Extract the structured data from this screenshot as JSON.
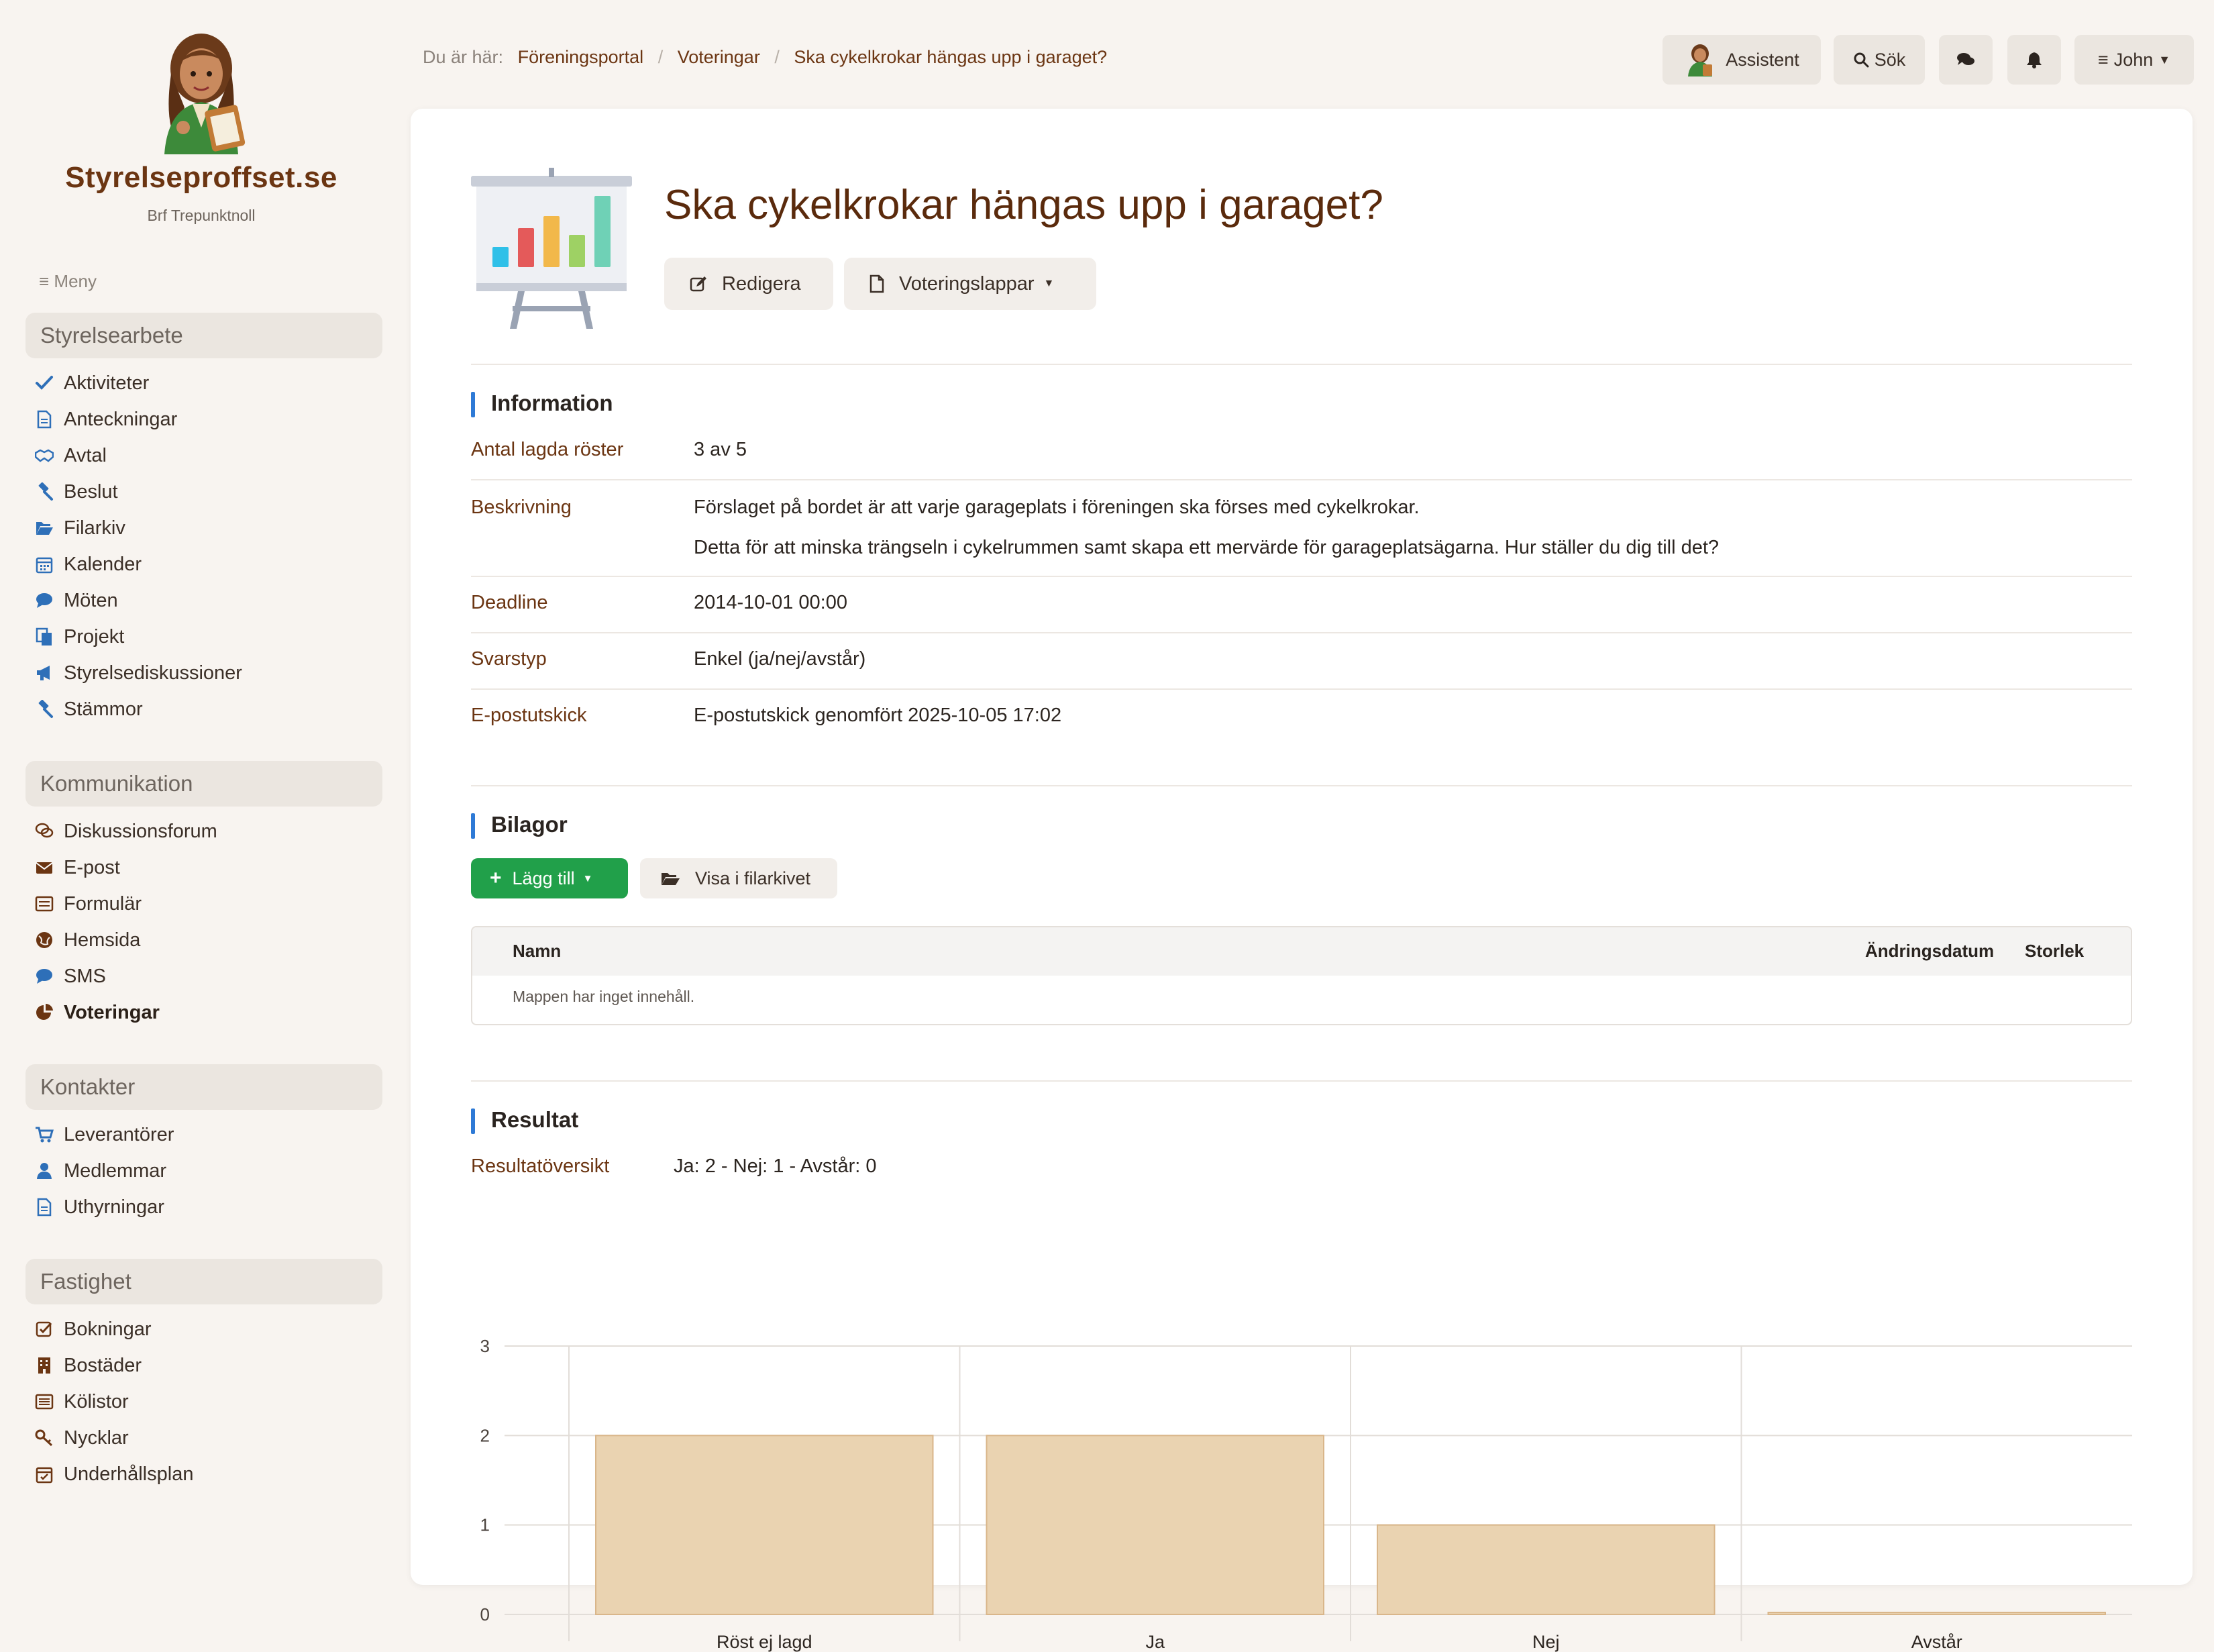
{
  "brand": {
    "name": "Styrelseproffset.se",
    "subtitle": "Brf Trepunktnoll"
  },
  "menu_label": "Meny",
  "sidebar": {
    "sections": [
      {
        "title": "Styrelsearbete",
        "items": [
          {
            "label": "Aktiviteter",
            "icon": "check-icon"
          },
          {
            "label": "Anteckningar",
            "icon": "document-icon"
          },
          {
            "label": "Avtal",
            "icon": "handshake-icon"
          },
          {
            "label": "Beslut",
            "icon": "gavel-icon"
          },
          {
            "label": "Filarkiv",
            "icon": "folder-open-icon"
          },
          {
            "label": "Kalender",
            "icon": "calendar-icon"
          },
          {
            "label": "Möten",
            "icon": "speech-bubble-icon"
          },
          {
            "label": "Projekt",
            "icon": "copy-icon"
          },
          {
            "label": "Styrelsediskussioner",
            "icon": "megaphone-icon"
          },
          {
            "label": "Stämmor",
            "icon": "gavel-icon"
          }
        ]
      },
      {
        "title": "Kommunikation",
        "items": [
          {
            "label": "Diskussionsforum",
            "icon": "comments-icon"
          },
          {
            "label": "E-post",
            "icon": "envelope-icon"
          },
          {
            "label": "Formulär",
            "icon": "form-icon"
          },
          {
            "label": "Hemsida",
            "icon": "globe-icon"
          },
          {
            "label": "SMS",
            "icon": "speech-bubble-icon"
          },
          {
            "label": "Voteringar",
            "icon": "pie-chart-icon",
            "active": true
          }
        ]
      },
      {
        "title": "Kontakter",
        "items": [
          {
            "label": "Leverantörer",
            "icon": "cart-icon"
          },
          {
            "label": "Medlemmar",
            "icon": "user-icon"
          },
          {
            "label": "Uthyrningar",
            "icon": "document-icon"
          }
        ]
      },
      {
        "title": "Fastighet",
        "items": [
          {
            "label": "Bokningar",
            "icon": "checkbox-icon"
          },
          {
            "label": "Bostäder",
            "icon": "building-icon"
          },
          {
            "label": "Kölistor",
            "icon": "list-icon"
          },
          {
            "label": "Nycklar",
            "icon": "key-icon"
          },
          {
            "label": "Underhållsplan",
            "icon": "calendar-check-icon"
          }
        ]
      }
    ]
  },
  "breadcrumb": {
    "prefix": "Du är här:",
    "items": [
      "Föreningsportal",
      "Voteringar",
      "Ska cykelkrokar hängas upp i garaget?"
    ]
  },
  "topbar": {
    "assistant": "Assistent",
    "search": "Sök",
    "user": "John"
  },
  "page": {
    "title": "Ska cykelkrokar hängas upp i garaget?",
    "edit_label": "Redigera",
    "ballots_label": "Voteringslappar"
  },
  "information": {
    "title": "Information",
    "rows": [
      {
        "key": "Antal lagda röster",
        "value": "3 av 5"
      },
      {
        "key": "Beskrivning",
        "value": "Förslaget på bordet är att varje garageplats i föreningen ska förses med cykelkrokar.",
        "value2": "Detta för att minska trängseln i cykelrummen samt skapa ett mervärde för garageplatsägarna. Hur ställer du dig till det?"
      },
      {
        "key": "Deadline",
        "value": "2014-10-01 00:00"
      },
      {
        "key": "Svarstyp",
        "value": "Enkel (ja/nej/avstår)"
      },
      {
        "key": "E-postutskick",
        "value": "E-postutskick genomfört 2025-10-05 17:02"
      }
    ]
  },
  "attachments": {
    "title": "Bilagor",
    "add_label": "Lägg till",
    "show_label": "Visa i filarkivet",
    "columns": [
      "Namn",
      "Ändringsdatum",
      "Storlek"
    ],
    "empty": "Mappen har inget innehåll."
  },
  "results": {
    "title": "Resultat",
    "summary_label": "Resultatöversikt",
    "summary": "Ja: 2 - Nej: 1 - Avstår: 0"
  },
  "colors": {
    "accent": "#2e7ad6",
    "brand": "#6b3512",
    "bar_fill": "#ead3b1",
    "bar_stroke": "#d9b68a",
    "add_button": "#21a04a"
  },
  "chart_data": {
    "type": "bar",
    "categories": [
      "Röst ej lagd",
      "Ja",
      "Nej",
      "Avstår"
    ],
    "values": [
      2,
      2,
      1,
      0
    ],
    "ylim": [
      0,
      3
    ],
    "yticks": [
      0,
      1,
      2,
      3
    ],
    "grid": true
  }
}
